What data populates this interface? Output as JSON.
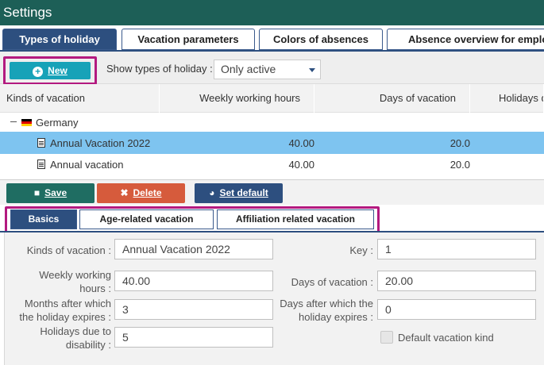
{
  "window": {
    "title": "Settings"
  },
  "main_tabs": [
    {
      "label": "Types of holiday"
    },
    {
      "label": "Vacation parameters"
    },
    {
      "label": "Colors of absences"
    },
    {
      "label": "Absence overview for employees"
    }
  ],
  "toolbar": {
    "new_label": "New",
    "show_label": "Show types of holiday :",
    "select_value": "Only active"
  },
  "grid": {
    "columns": [
      "Kinds of vacation",
      "Weekly working hours",
      "Days of vacation",
      "Holidays due to disability"
    ],
    "group": {
      "label": "Germany"
    },
    "rows": [
      {
        "name": "Annual Vacation 2022",
        "hours": "40.00",
        "days": "20.0",
        "selected": true
      },
      {
        "name": "Annual vacation",
        "hours": "40.00",
        "days": "20.0",
        "selected": false
      }
    ]
  },
  "actions": {
    "save": "Save",
    "delete": "Delete",
    "set_default": "Set default"
  },
  "sub_tabs": [
    {
      "label": "Basics"
    },
    {
      "label": "Age-related vacation"
    },
    {
      "label": "Affiliation related vacation"
    }
  ],
  "form": {
    "kind_label": "Kinds of vacation :",
    "kind_value": "Annual Vacation 2022",
    "key_label": "Key :",
    "key_value": "1",
    "hours_label_1": "Weekly working",
    "hours_label_2": "hours :",
    "hours_value": "40.00",
    "days_label": "Days of vacation :",
    "days_value": "20.00",
    "months_label_1": "Months after which",
    "months_label_2": "the holiday expires :",
    "months_value": "3",
    "dexp_label_1": "Days after which the",
    "dexp_label_2": "holiday expires :",
    "dexp_value": "0",
    "dis_label_1": "Holidays due to",
    "dis_label_2": "disability :",
    "dis_value": "5",
    "default_kind_label": "Default vacation kind"
  },
  "colors": {
    "titlebar": "#1d5f57",
    "tab_active": "#2d4f7f",
    "new_button": "#17a2b8",
    "save_button": "#1f6d62",
    "delete_button": "#d65b3c",
    "set_default_button": "#2d4f7f",
    "selected_row": "#7ec4f0",
    "highlight": "#b3197f"
  }
}
